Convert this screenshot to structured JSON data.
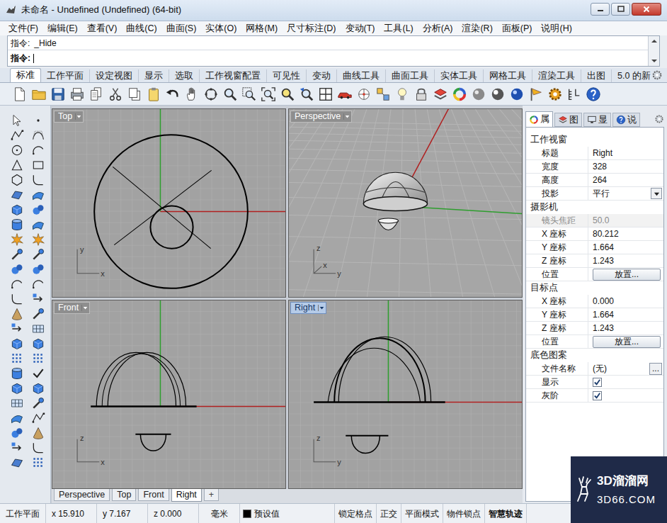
{
  "window": {
    "title": "未命名 - Undefined (Undefined) (64-bit)"
  },
  "menu": [
    "文件(F)",
    "编辑(E)",
    "查看(V)",
    "曲线(C)",
    "曲面(S)",
    "实体(O)",
    "网格(M)",
    "尺寸标注(D)",
    "变动(T)",
    "工具(L)",
    "分析(A)",
    "渲染(R)",
    "面板(P)",
    "说明(H)"
  ],
  "command": {
    "history": {
      "label": "指令:",
      "value": "_Hide"
    },
    "prompt": {
      "label": "指令:"
    }
  },
  "toolbar_tabs": [
    {
      "label": "标准",
      "selected": true
    },
    {
      "label": "工作平面",
      "selected": false
    },
    {
      "label": "设定视图",
      "selected": false
    },
    {
      "label": "显示",
      "selected": false
    },
    {
      "label": "选取",
      "selected": false
    },
    {
      "label": "工作视窗配置",
      "selected": false
    },
    {
      "label": "可见性",
      "selected": false
    },
    {
      "label": "变动",
      "selected": false
    },
    {
      "label": "曲线工具",
      "selected": false
    },
    {
      "label": "曲面工具",
      "selected": false
    },
    {
      "label": "实体工具",
      "selected": false
    },
    {
      "label": "网格工具",
      "selected": false
    },
    {
      "label": "渲染工具",
      "selected": false
    },
    {
      "label": "出图",
      "selected": false
    },
    {
      "label": "5.0 的新",
      "selected": false
    }
  ],
  "viewports": [
    {
      "title": "Top",
      "selected": false,
      "axes": [
        "y",
        "x"
      ]
    },
    {
      "title": "Perspective",
      "selected": false,
      "axes": [
        "z",
        "y",
        "x"
      ]
    },
    {
      "title": "Front",
      "selected": false,
      "axes": [
        "z",
        "x"
      ]
    },
    {
      "title": "Right",
      "selected": true,
      "axes": [
        "z",
        "y"
      ]
    }
  ],
  "viewport_tabs": {
    "tabs": [
      {
        "label": "Perspective",
        "selected": false
      },
      {
        "label": "Top",
        "selected": false
      },
      {
        "label": "Front",
        "selected": false
      },
      {
        "label": "Right",
        "selected": true
      }
    ],
    "add": "+"
  },
  "panel": {
    "tabs": [
      {
        "label": "属",
        "selected": true
      },
      {
        "label": "图",
        "selected": false
      },
      {
        "label": "显",
        "selected": false
      },
      {
        "label": "说",
        "selected": false
      }
    ],
    "sections": [
      {
        "title": "工作视窗",
        "rows": [
          {
            "kind": "text",
            "label": "标题",
            "value": "Right",
            "disabled": false
          },
          {
            "kind": "text",
            "label": "宽度",
            "value": "328",
            "disabled": false
          },
          {
            "kind": "text",
            "label": "高度",
            "value": "264",
            "disabled": false
          },
          {
            "kind": "select",
            "label": "投影",
            "value": "平行",
            "disabled": false
          }
        ]
      },
      {
        "title": "摄影机",
        "rows": [
          {
            "kind": "text",
            "label": "镜头焦距",
            "value": "50.0",
            "disabled": true
          },
          {
            "kind": "text",
            "label": "X 座标",
            "value": "80.212",
            "disabled": false
          },
          {
            "kind": "text",
            "label": "Y 座标",
            "value": "1.664",
            "disabled": false
          },
          {
            "kind": "text",
            "label": "Z 座标",
            "value": "1.243",
            "disabled": false
          },
          {
            "kind": "button",
            "label": "位置",
            "value": "放置...",
            "disabled": false
          }
        ]
      },
      {
        "title": "目标点",
        "rows": [
          {
            "kind": "text",
            "label": "X 座标",
            "value": "0.000",
            "disabled": false
          },
          {
            "kind": "text",
            "label": "Y 座标",
            "value": "1.664",
            "disabled": false
          },
          {
            "kind": "text",
            "label": "Z 座标",
            "value": "1.243",
            "disabled": false
          },
          {
            "kind": "button",
            "label": "位置",
            "value": "放置...",
            "disabled": false
          }
        ]
      },
      {
        "title": "底色图案",
        "rows": [
          {
            "kind": "file",
            "label": "文件名称",
            "value": "(无)",
            "button": "...",
            "disabled": false
          },
          {
            "kind": "checkbox",
            "label": "显示",
            "checked": true,
            "disabled": false
          },
          {
            "kind": "checkbox",
            "label": "灰阶",
            "checked": true,
            "disabled": false
          }
        ]
      }
    ]
  },
  "status_bar": {
    "workplane": "工作平面",
    "coords": [
      "x 15.910",
      "y 7.167",
      "z 0.000"
    ],
    "units": "毫米",
    "layer": "预设值",
    "toggles": [
      {
        "label": "锁定格点",
        "on": false
      },
      {
        "label": "正交",
        "on": false
      },
      {
        "label": "平面模式",
        "on": false
      },
      {
        "label": "物件锁点",
        "on": false
      },
      {
        "label": "智慧轨迹",
        "on": true
      }
    ]
  },
  "watermark": {
    "brand": "3D溜溜网",
    "url": "3D66.COM"
  }
}
